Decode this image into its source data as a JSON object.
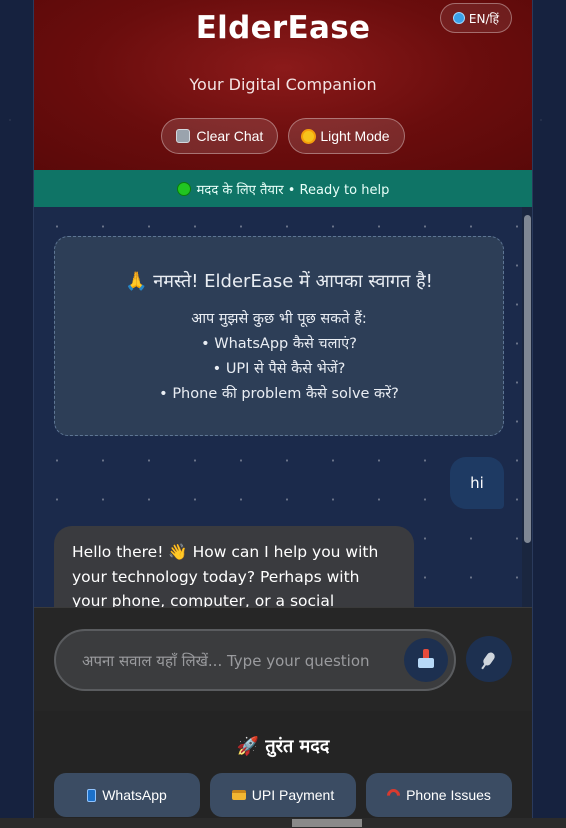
{
  "header": {
    "brand": "ElderEase",
    "tagline": "Your Digital Companion",
    "language_toggle": "EN/हिं",
    "clear_chat": "Clear Chat",
    "light_mode": "Light Mode"
  },
  "status": {
    "text": "मदद के लिए तैयार • Ready to help"
  },
  "welcome": {
    "title": "🙏 नमस्ते! ElderEase में आपका स्वागत है!",
    "intro": "आप मुझसे कुछ भी पूछ सकते हैं:",
    "items": [
      "• WhatsApp कैसे चलाएं?",
      "• UPI से पैसे कैसे भेजें?",
      "• Phone की problem कैसे solve करें?"
    ]
  },
  "messages": {
    "user": "hi",
    "bot": "Hello there! 👋 How can I help you with your technology today? Perhaps with your phone, computer, or a social"
  },
  "composer": {
    "placeholder": "अपना सवाल यहाँ लिखें... Type your question"
  },
  "quick_help": {
    "title": "🚀 तुरंत मदद",
    "buttons": [
      "WhatsApp",
      "UPI Payment",
      "Phone Issues"
    ]
  }
}
